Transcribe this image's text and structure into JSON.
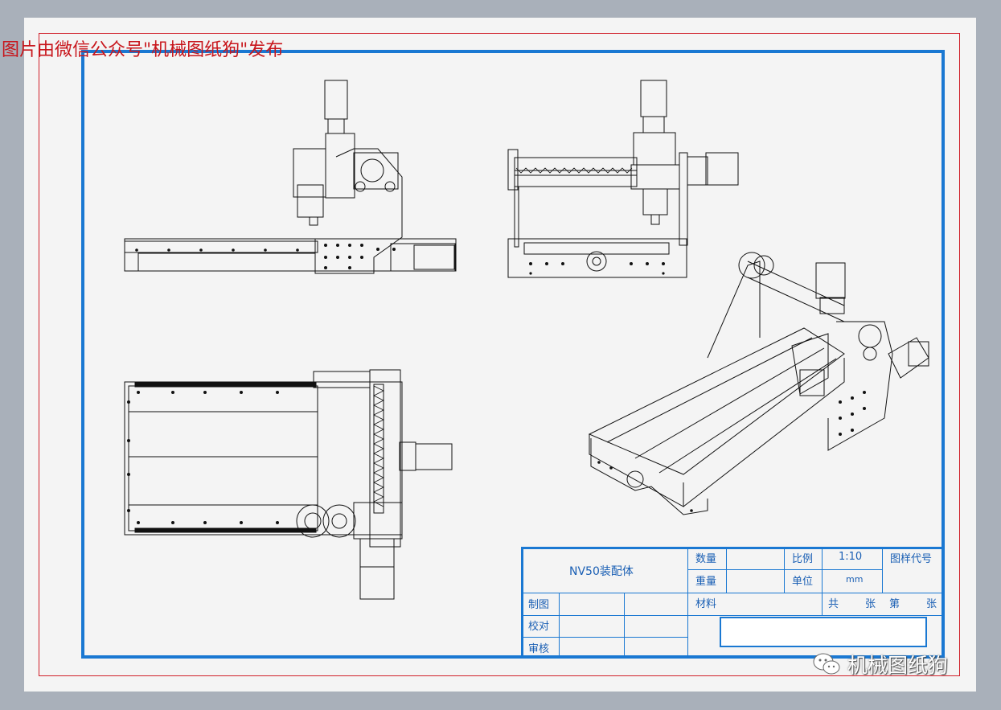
{
  "watermark_top": "图片由微信公众号\"机械图纸狗\"发布",
  "title_block": {
    "name": "NV50装配体",
    "qty_label": "数量",
    "weight_label": "重量",
    "scale_label": "比例",
    "scale_value": "1:10",
    "unit_label": "单位",
    "unit_value": "mm",
    "drawing_code_label": "图样代号",
    "material_label": "材料",
    "total_label": "共",
    "sheets_label": "张",
    "sheet_no_label": "第",
    "sheet_label_2": "张",
    "drawn_label": "制图",
    "checked_label": "校对",
    "approved_label": "审核"
  },
  "brand_watermark": "机械图纸狗",
  "colors": {
    "frame_red": "#d0202a",
    "frame_blue": "#1a78d2",
    "sheet": "#f4f4f4",
    "background": "#a9b0ba"
  },
  "icons": [
    "wechat-logo-icon"
  ]
}
